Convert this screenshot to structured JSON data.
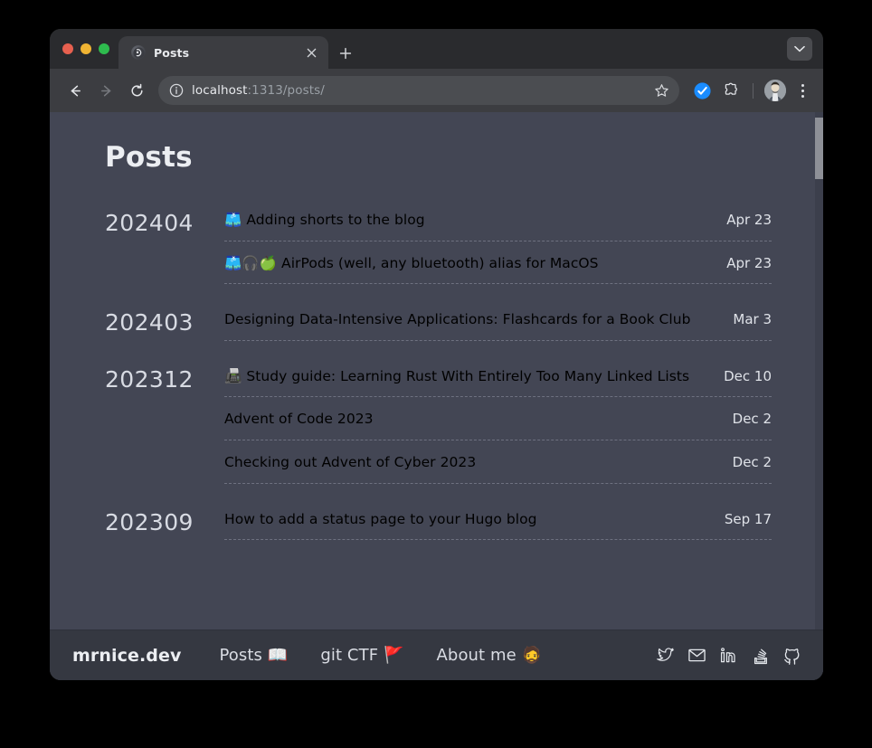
{
  "browser": {
    "tab": {
      "title": "Posts",
      "favicon_icon": "site-favicon",
      "close_icon": "close-icon"
    },
    "new_tab_icon": "plus-icon",
    "tab_list_icon": "chevron-down-icon",
    "traffic_lights": {
      "close_color": "#e7604f",
      "minimize_color": "#f0b433",
      "zoom_color": "#2ebb4e"
    },
    "toolbar": {
      "back_icon": "back-arrow-icon",
      "forward_icon": "forward-arrow-icon",
      "reload_icon": "reload-icon",
      "site_info_icon": "info-icon",
      "url_host": "localhost",
      "url_path": ":1313/posts/",
      "url_full": "localhost:1313/posts/",
      "bookmark_icon": "star-icon",
      "extension_icons": [
        "shield-check-icon",
        "puzzle-piece-icon"
      ],
      "avatar_icon": "avatar",
      "menu_icon": "three-dot-menu-icon"
    }
  },
  "page": {
    "title": "Posts",
    "groups": [
      {
        "year_month": "202404",
        "posts": [
          {
            "emoji": "🩳",
            "title": "Adding shorts to the blog",
            "date": "Apr 23"
          },
          {
            "emoji": "🩳🎧🍏",
            "title": "AirPods (well, any bluetooth) alias for MacOS",
            "date": "Apr 23"
          }
        ]
      },
      {
        "year_month": "202403",
        "posts": [
          {
            "emoji": "",
            "title": "Designing Data-Intensive Applications: Flashcards for a Book Club",
            "date": "Mar 3"
          }
        ]
      },
      {
        "year_month": "202312",
        "posts": [
          {
            "emoji": "📠",
            "title": "Study guide: Learning Rust With Entirely Too Many Linked Lists",
            "date": "Dec 10"
          },
          {
            "emoji": "",
            "title": "Advent of Code 2023",
            "date": "Dec 2"
          },
          {
            "emoji": "",
            "title": "Checking out Advent of Cyber 2023",
            "date": "Dec 2"
          }
        ]
      },
      {
        "year_month": "202309",
        "posts": [
          {
            "emoji": "",
            "title": "How to add a status page to your Hugo blog",
            "date": "Sep 17"
          }
        ]
      }
    ]
  },
  "footer": {
    "brand": "mrnice.dev",
    "links": [
      {
        "label": "Posts 📖",
        "name": "posts"
      },
      {
        "label": "git CTF 🚩",
        "name": "git-ctf"
      },
      {
        "label": "About me 🧔",
        "name": "about-me"
      }
    ],
    "socials": [
      {
        "name": "twitter-icon"
      },
      {
        "name": "email-icon"
      },
      {
        "name": "linkedin-icon"
      },
      {
        "name": "stackoverflow-icon"
      },
      {
        "name": "github-icon"
      }
    ]
  },
  "colors": {
    "page_background": "#434654",
    "footer_background": "#353841",
    "browser_toolbar": "#3c3d41",
    "tab_strip": "#2a2b2e",
    "text_primary": "#e9ebef",
    "separator": "#6e7180"
  }
}
